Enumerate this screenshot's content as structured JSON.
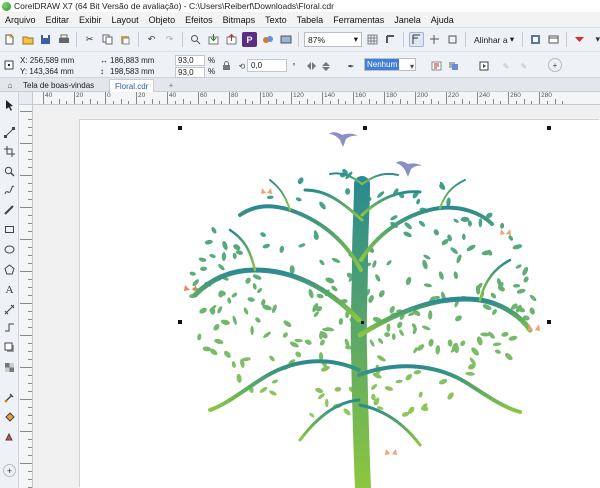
{
  "window": {
    "title": "CorelDRAW X7 (64 Bit Versão de avaliação) - C:\\Users\\Reiberf\\Downloads\\Floral.cdr"
  },
  "menu": [
    "Arquivo",
    "Editar",
    "Exibir",
    "Layout",
    "Objeto",
    "Efeitos",
    "Bitmaps",
    "Texto",
    "Tabela",
    "Ferramentas",
    "Janela",
    "Ajuda"
  ],
  "toolbar": {
    "zoom": "87%",
    "align_label": "Alinhar a"
  },
  "properties": {
    "x": "X: 256,589 mm",
    "y": "Y: 143,364 mm",
    "width": "186,883 mm",
    "height": "198,583 mm",
    "scale_x": "93,0",
    "scale_y": "93,0",
    "percent": "%",
    "rotation": "0,0",
    "outline": "Nenhum"
  },
  "tabs": [
    "Tela de boas-vindas",
    "Floral.cdr"
  ],
  "ruler": {
    "unit": "milímetros",
    "h_labels": [
      "40",
      "20",
      "0",
      "20",
      "40",
      "60",
      "80",
      "100",
      "120",
      "140",
      "160",
      "180",
      "200",
      "220",
      "240",
      "260",
      "280"
    ]
  },
  "colors": {
    "trunk_top": "#2a8a8f",
    "trunk_bottom": "#8dc63f",
    "leaf_top": "#3a9a8e",
    "leaf_bottom": "#9acd52",
    "bird": "#8a8fc4",
    "butterfly": "#f0a070",
    "selection": "#3f7fd6"
  },
  "icons": {
    "toolbar": [
      "new-icon",
      "open-icon",
      "save-icon",
      "print-icon",
      "cut-icon",
      "copy-icon",
      "paste-icon",
      "undo-icon",
      "redo-icon",
      "search-icon",
      "import-icon",
      "export-icon",
      "publish-icon",
      "full-screen-icon",
      "rulers-icon",
      "grid-icon",
      "snap-icon",
      "options-icon",
      "launch-icon"
    ],
    "tools": [
      "pick-tool-icon",
      "shape-tool-icon",
      "crop-tool-icon",
      "zoom-tool-icon",
      "freehand-tool-icon",
      "artistic-media-icon",
      "rectangle-tool-icon",
      "ellipse-tool-icon",
      "polygon-tool-icon",
      "text-tool-icon",
      "parallel-dimension-icon",
      "connector-tool-icon",
      "drop-shadow-icon",
      "transparency-icon",
      "eyedropper-icon",
      "interactive-fill-icon",
      "smart-fill-icon",
      "add-tool-icon"
    ]
  }
}
